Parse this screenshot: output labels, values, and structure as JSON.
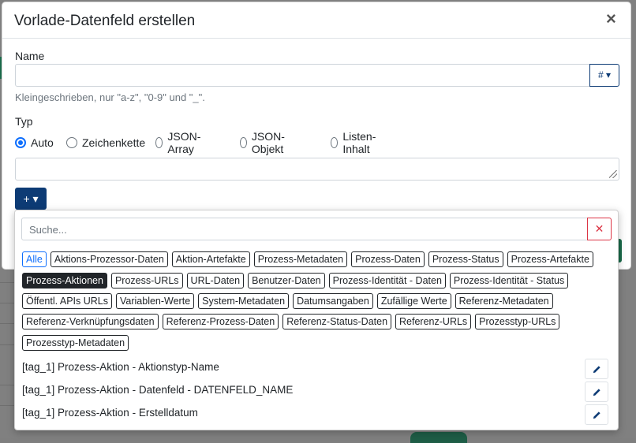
{
  "modal": {
    "title": "Vorlade-Datenfeld erstellen",
    "close_label": "×",
    "name_label": "Name",
    "name_value": "",
    "hash_button": "# ▾",
    "help_text": "Kleingeschrieben, nur \"a-z\", \"0-9\" und \"_\".",
    "type_label": "Typ",
    "type_options": [
      {
        "label": "Auto",
        "checked": true
      },
      {
        "label": "Zeichenkette",
        "checked": false
      },
      {
        "label": "JSON-Array",
        "checked": false
      },
      {
        "label": "JSON-Objekt",
        "checked": false
      },
      {
        "label": "Listen-Inhalt",
        "checked": false
      }
    ],
    "value_text": "",
    "add_button": "+ ▾"
  },
  "dropdown": {
    "search_placeholder": "Suche...",
    "clear_label": "✕",
    "categories": [
      "Alle",
      "Aktions-Prozessor-Daten",
      "Aktion-Artefakte",
      "Prozess-Metadaten",
      "Prozess-Daten",
      "Prozess-Status",
      "Prozess-Artefakte",
      "Prozess-Aktionen",
      "Prozess-URLs",
      "URL-Daten",
      "Benutzer-Daten",
      "Prozess-Identität - Daten",
      "Prozess-Identität - Status",
      "Öffentl. APIs URLs",
      "Variablen-Werte",
      "System-Metadaten",
      "Datumsangaben",
      "Zufällige Werte",
      "Referenz-Metadaten",
      "Referenz-Verknüpfungsdaten",
      "Referenz-Prozess-Daten",
      "Referenz-Status-Daten",
      "Referenz-URLs",
      "Prozesstyp-URLs",
      "Prozesstyp-Metadaten"
    ],
    "active_category": "Alle",
    "highlighted_category": "Prozess-Aktionen",
    "results": [
      "[tag_1] Prozess-Aktion - Aktionstyp-Name",
      "[tag_1] Prozess-Aktion - Datenfeld - DATENFELD_NAME",
      "[tag_1] Prozess-Aktion - Erstelldatum"
    ]
  },
  "colors": {
    "primary_dark": "#0d3b75",
    "radio_accent": "#0d6efd",
    "danger": "#dc3545",
    "chip_active_bg": "#212529",
    "overlay": "#808080"
  },
  "icons": [
    "close-icon",
    "caret-down-icon",
    "resize-grip-icon",
    "pencil-icon"
  ]
}
